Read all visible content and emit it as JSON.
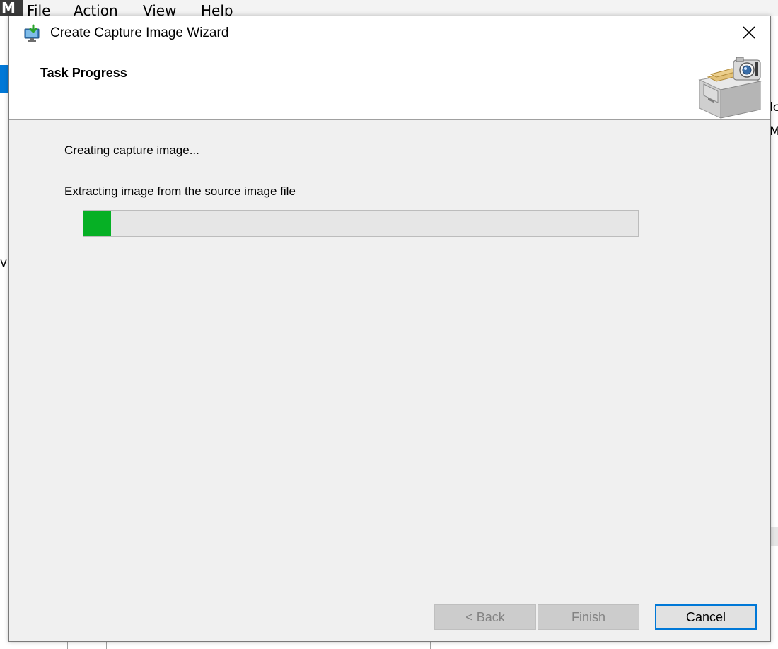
{
  "background_app": {
    "logo_text": "M",
    "menu": [
      "File",
      "Action",
      "View",
      "Help"
    ],
    "left_partial_text": "vi",
    "right_partial_texts": [
      "lc",
      "MI"
    ]
  },
  "dialog": {
    "title": "Create Capture Image Wizard",
    "title_icon": "monitor-download-icon",
    "close_icon": "close-icon",
    "header": {
      "title": "Task Progress",
      "graphic": "file-cabinet-camera-icon"
    },
    "body": {
      "status": "Creating capture image...",
      "detail": "Extracting image from the source image file",
      "progress_fraction": 0.05
    },
    "buttons": {
      "back": "< Back",
      "finish": "Finish",
      "cancel": "Cancel"
    }
  },
  "colors": {
    "progress_fill": "#06b025",
    "accent": "#0078d7",
    "dialog_bg": "#f0f0f0"
  }
}
